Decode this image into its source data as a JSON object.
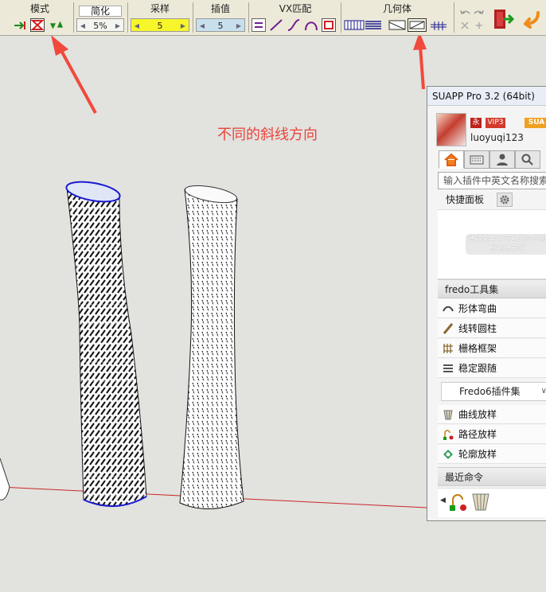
{
  "toolbar": {
    "groups": {
      "mode": "模式",
      "simplify": "简化",
      "sample": "采样",
      "interp": "插值",
      "vx": "VX匹配",
      "geometry": "几何体"
    },
    "simplify_value": "5%",
    "sample_value": "5",
    "interp_value": "5",
    "colors": {
      "sample_bg": "#f6f62a",
      "interp_bg": "#c8e0ee"
    }
  },
  "annotation": "不同的斜线方向",
  "panel": {
    "title": "SUAPP Pro 3.2 (64bit)",
    "username": "luoyuqi123",
    "vip_tag": "VIP3",
    "brand_tag": "SUA",
    "search_placeholder": "输入插件中英文名称搜索",
    "quick_panel": "快捷面板",
    "quick_hint": "请将菜单中常用的命令图标拖进来哦",
    "section_fredo": "fredo工具集",
    "items": [
      "形体弯曲",
      "线转圆柱",
      "栅格框架",
      "稳定跟随"
    ],
    "dropdown": "Fredo6插件集",
    "items2": [
      "曲线放样",
      "路径放样",
      "轮廓放样"
    ],
    "recent": "最近命令",
    "icons": [
      "home-icon",
      "keyboard-icon",
      "user-icon",
      "search-icon",
      "gear-icon"
    ]
  },
  "colors": {
    "accent": "#e8443a",
    "ground_line": "#c82828",
    "selection": "#1a1ad0"
  }
}
